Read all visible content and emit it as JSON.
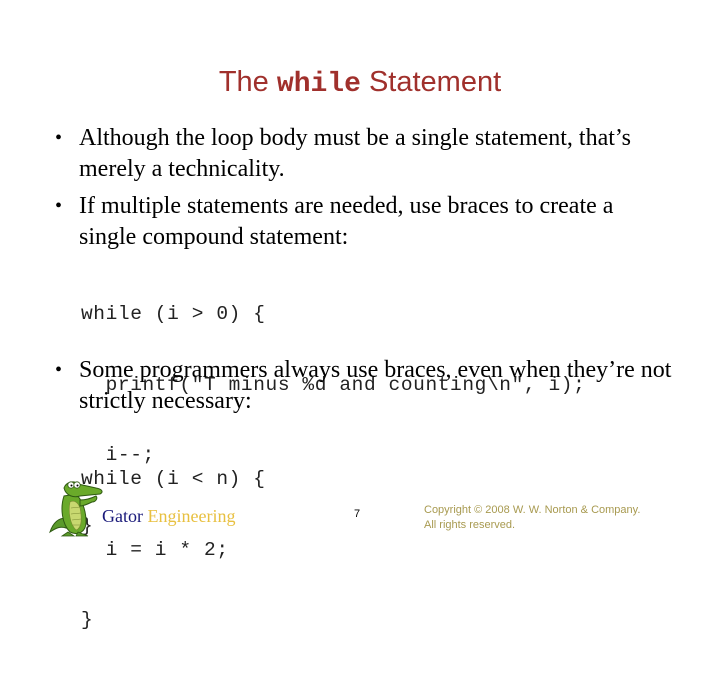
{
  "slide": {
    "title": {
      "prefix": "The",
      "code": "while",
      "suffix": "Statement",
      "color": "#a0302c"
    },
    "bullets": [
      {
        "text": "Although the loop body must be a single statement, that’s merely a technicality."
      },
      {
        "text": "If multiple statements are needed, use braces to create a single compound statement:"
      },
      {
        "text": "Some programmers always use braces, even when they’re not strictly necessary:"
      }
    ],
    "code_blocks": [
      {
        "lines": [
          "while (i > 0) {",
          "  printf(\"T minus %d and counting\\n\", i);",
          "  i--;",
          "}"
        ]
      },
      {
        "lines": [
          "while (i < n) {",
          "  i = i * 2;",
          "}"
        ]
      }
    ],
    "bullet_glyph": "•"
  },
  "footer": {
    "logo_icon": "gator-mascot-icon",
    "brand_primary": "Gator",
    "brand_secondary": "Engineering",
    "brand_primary_color": "#1a1a7a",
    "brand_secondary_color": "#e8c040",
    "page_number": "7",
    "copyright_line1": "Copyright © 2008 W. W. Norton & Company.",
    "copyright_line2": "All rights reserved."
  }
}
